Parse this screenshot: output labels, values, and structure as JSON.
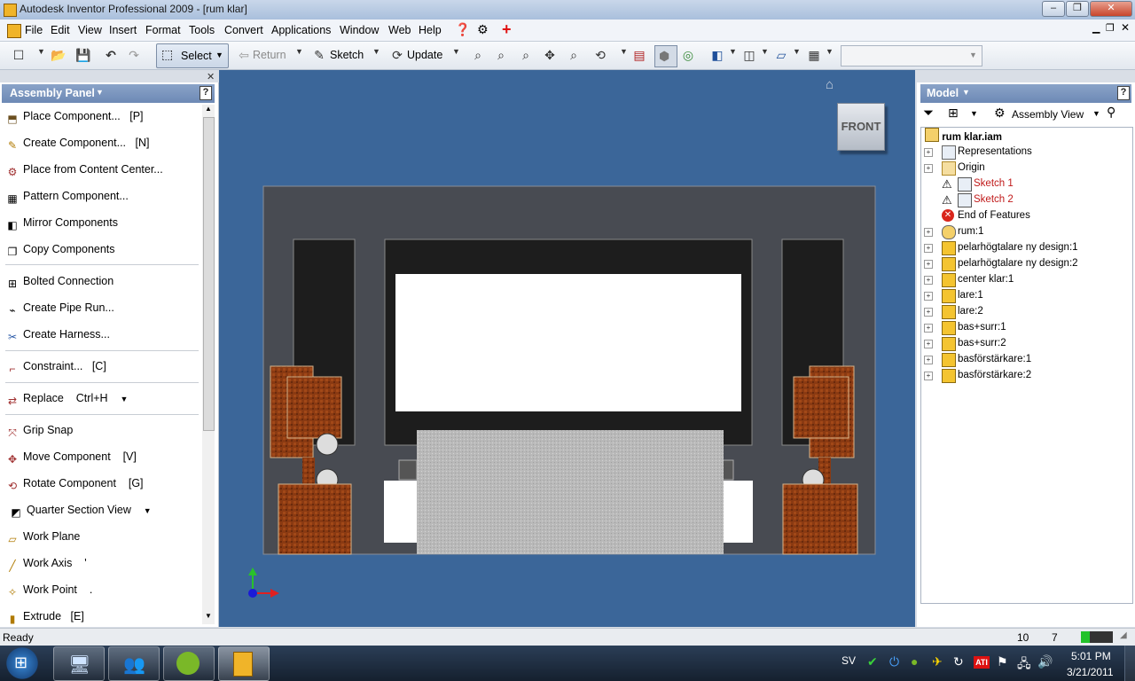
{
  "window": {
    "title": "Autodesk Inventor Professional 2009 - [rum klar]"
  },
  "menu": [
    "File",
    "Edit",
    "View",
    "Insert",
    "Format",
    "Tools",
    "Convert",
    "Applications",
    "Window",
    "Web",
    "Help"
  ],
  "toolbar": {
    "select": "Select",
    "return": "Return",
    "sketch": "Sketch",
    "update": "Update"
  },
  "assembly_panel": {
    "title": "Assembly Panel",
    "items": [
      {
        "label": "Place Component...",
        "shortcut": "[P]"
      },
      {
        "label": "Create Component...",
        "shortcut": "[N]"
      },
      {
        "label": "Place from Content Center...",
        "shortcut": ""
      },
      {
        "label": "Pattern Component...",
        "shortcut": ""
      },
      {
        "label": "Mirror Components",
        "shortcut": ""
      },
      {
        "label": "Copy Components",
        "shortcut": ""
      },
      {
        "label": "Bolted Connection",
        "shortcut": ""
      },
      {
        "label": "Create Pipe Run...",
        "shortcut": ""
      },
      {
        "label": "Create Harness...",
        "shortcut": ""
      },
      {
        "label": "Constraint...",
        "shortcut": "[C]"
      },
      {
        "label": "Replace",
        "shortcut": "Ctrl+H"
      },
      {
        "label": "Grip Snap",
        "shortcut": ""
      },
      {
        "label": "Move Component",
        "shortcut": "[V]"
      },
      {
        "label": "Rotate Component",
        "shortcut": "[G]"
      },
      {
        "label": "Quarter Section View",
        "shortcut": ""
      },
      {
        "label": "Work Plane",
        "shortcut": ""
      },
      {
        "label": "Work Axis",
        "shortcut": "'"
      },
      {
        "label": "Work Point",
        "shortcut": "."
      },
      {
        "label": "Extrude",
        "shortcut": "[E]"
      }
    ]
  },
  "viewcube": {
    "face": "FRONT"
  },
  "model_panel": {
    "title": "Model",
    "view": "Assembly View",
    "root": "rum klar.iam",
    "nodes": [
      "Representations",
      "Origin",
      "Sketch 1",
      "Sketch 2",
      "End of Features",
      "rum:1",
      "pelarhögtalare ny design:1",
      "pelarhögtalare ny design:2",
      "center klar:1",
      "lare:1",
      "lare:2",
      "bas+surr:1",
      "bas+surr:2",
      "basförstärkare:1",
      "basförstärkare:2"
    ]
  },
  "status": {
    "text": "Ready",
    "count1": "10",
    "count2": "7"
  },
  "taskbar": {
    "lang": "SV",
    "time": "5:01 PM",
    "date": "3/21/2011",
    "ati": "ATI"
  }
}
